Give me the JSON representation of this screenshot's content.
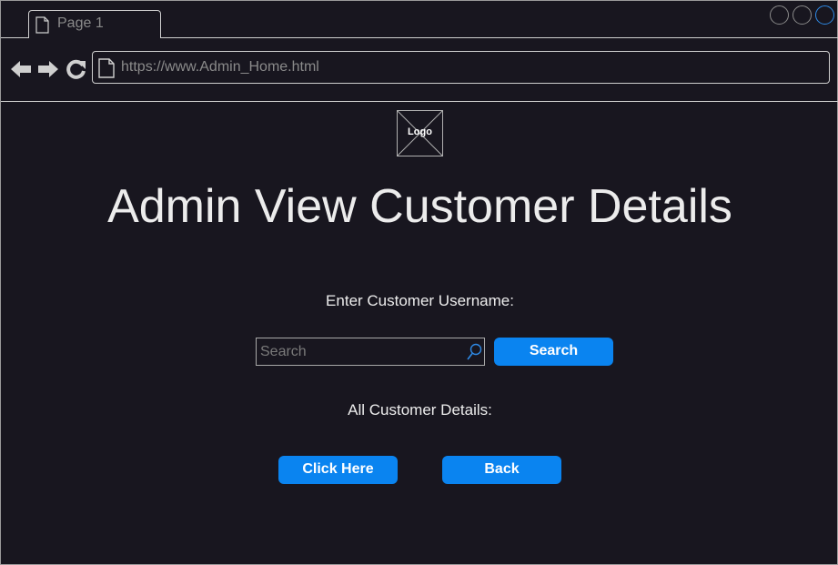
{
  "browser": {
    "tab_label": "Page 1",
    "url": "https://www.Admin_Home.html",
    "window_controls": [
      "minimize",
      "maximize",
      "close"
    ],
    "nav_icons": [
      "back-arrow-icon",
      "forward-arrow-icon",
      "reload-icon"
    ]
  },
  "page": {
    "logo_label": "Logo",
    "title": "Admin View Customer Details",
    "username_label": "Enter Customer Username:",
    "search": {
      "placeholder": "Search",
      "value": ""
    },
    "search_button": "Search",
    "all_details_label": "All Customer Details:",
    "click_here_button": "Click Here",
    "back_button": "Back"
  },
  "colors": {
    "background": "#18161f",
    "accent": "#0a84f0",
    "text": "#e6e6e6",
    "muted": "#8a8a8a"
  }
}
